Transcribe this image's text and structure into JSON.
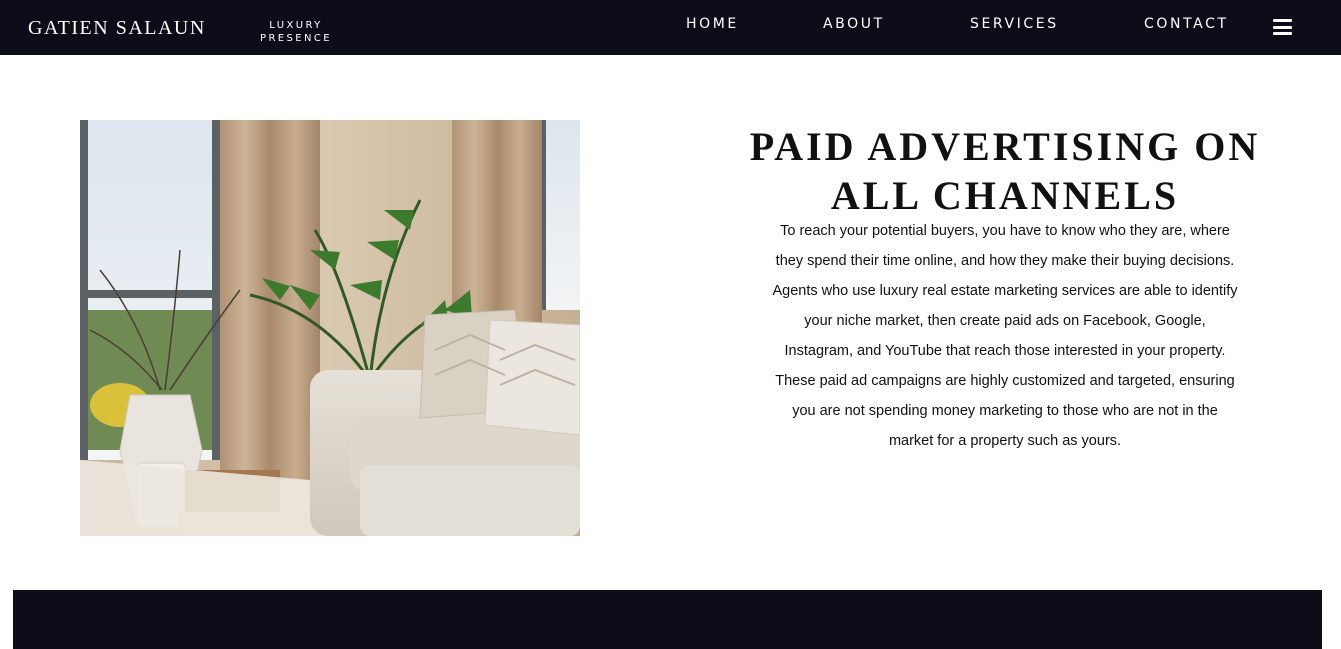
{
  "header": {
    "brand": "GATIEN SALAUN",
    "badge_line1": "LUXURY",
    "badge_line2": "PRESENCE",
    "nav": {
      "home": "HOME",
      "about": "ABOUT",
      "services": "SERVICES",
      "contact": "CONTACT"
    },
    "menu_icon": "hamburger-menu-icon"
  },
  "main": {
    "image_subject": "living-room-interior",
    "heading_lines": [
      "PAID ADVERTISING ON",
      "ALL CHANNELS"
    ],
    "body_lines": [
      "To reach your potential buyers, you have to know who they are, where",
      "they spend their time online, and how they make their buying decisions.",
      "Agents who use luxury real estate marketing services are able to identify",
      "your niche market, then create paid ads on Facebook, Google,",
      "Instagram, and YouTube that reach those interested in your property.",
      "These paid ad campaigns are highly customized and targeted, ensuring",
      "you are not spending money marketing to those who are not in the",
      "market for a property such as yours."
    ]
  },
  "colors": {
    "header_bg": "#0d0d1a",
    "page_bg": "#ffffff",
    "text": "#111111"
  }
}
